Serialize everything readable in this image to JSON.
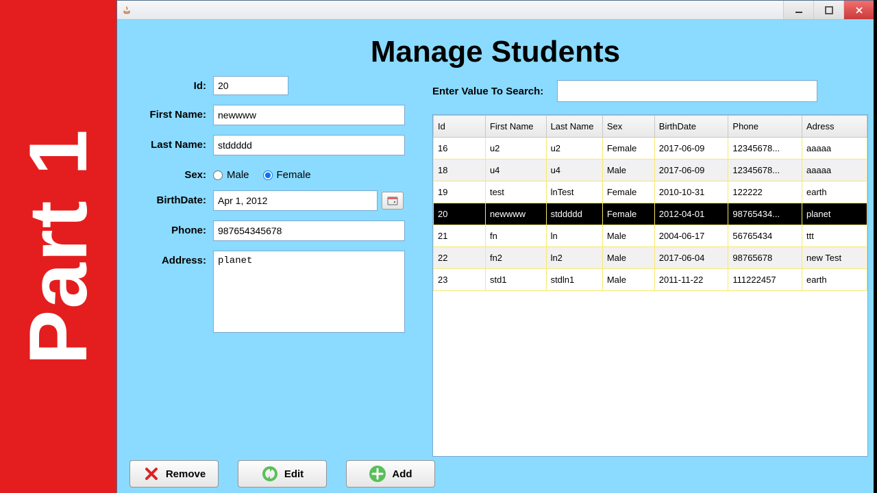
{
  "side_label": "Part 1",
  "page_title": "Manage Students",
  "form": {
    "labels": {
      "id": "Id:",
      "first_name": "First Name:",
      "last_name": "Last Name:",
      "sex": "Sex:",
      "birth_date": "BirthDate:",
      "phone": "Phone:",
      "address": "Address:"
    },
    "values": {
      "id": "20",
      "first_name": "newwww",
      "last_name": "stddddd",
      "birth_date": "Apr 1, 2012",
      "phone": "987654345678",
      "address": "planet"
    },
    "sex": {
      "male": "Male",
      "female": "Female",
      "selected": "Female"
    }
  },
  "buttons": {
    "remove": "Remove",
    "edit": "Edit",
    "add": "Add"
  },
  "search": {
    "label": "Enter Value To Search:",
    "value": ""
  },
  "table": {
    "headers": [
      "Id",
      "First Name",
      "Last Name",
      "Sex",
      "BirthDate",
      "Phone",
      "Adress"
    ],
    "selected_id": "20",
    "rows": [
      {
        "id": "16",
        "first_name": "u2",
        "last_name": "u2",
        "sex": "Female",
        "birth_date": "2017-06-09",
        "phone": "12345678...",
        "address": "aaaaa"
      },
      {
        "id": "18",
        "first_name": "u4",
        "last_name": "u4",
        "sex": "Male",
        "birth_date": "2017-06-09",
        "phone": "12345678...",
        "address": "aaaaa"
      },
      {
        "id": "19",
        "first_name": "test",
        "last_name": "lnTest",
        "sex": "Female",
        "birth_date": "2010-10-31",
        "phone": "122222",
        "address": "earth"
      },
      {
        "id": "20",
        "first_name": "newwww",
        "last_name": "stddddd",
        "sex": "Female",
        "birth_date": "2012-04-01",
        "phone": "98765434...",
        "address": "planet"
      },
      {
        "id": "21",
        "first_name": "fn",
        "last_name": "ln",
        "sex": "Male",
        "birth_date": "2004-06-17",
        "phone": "56765434",
        "address": "ttt"
      },
      {
        "id": "22",
        "first_name": "fn2",
        "last_name": "ln2",
        "sex": "Male",
        "birth_date": "2017-06-04",
        "phone": "98765678",
        "address": "new Test"
      },
      {
        "id": "23",
        "first_name": "std1",
        "last_name": "stdln1",
        "sex": "Male",
        "birth_date": "2011-11-22",
        "phone": "111222457",
        "address": "earth"
      }
    ]
  }
}
